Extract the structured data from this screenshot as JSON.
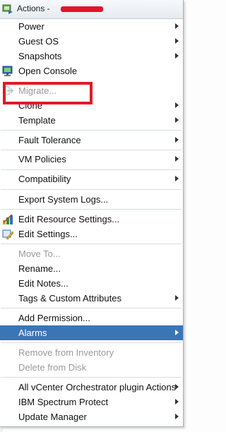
{
  "menu": {
    "title": "Actions -",
    "items": [
      {
        "label": "Power",
        "submenu": true,
        "disabled": false
      },
      {
        "label": "Guest OS",
        "submenu": true,
        "disabled": false
      },
      {
        "label": "Snapshots",
        "submenu": true,
        "disabled": false
      },
      {
        "label": "Open Console",
        "submenu": false,
        "disabled": false,
        "icon": "console-icon"
      },
      {
        "label": "Migrate...",
        "submenu": false,
        "disabled": true,
        "icon": "migrate-icon"
      },
      {
        "label": "Clone",
        "submenu": true,
        "disabled": false
      },
      {
        "label": "Template",
        "submenu": true,
        "disabled": false
      },
      {
        "label": "Fault Tolerance",
        "submenu": true,
        "disabled": false
      },
      {
        "label": "VM Policies",
        "submenu": true,
        "disabled": false
      },
      {
        "label": "Compatibility",
        "submenu": true,
        "disabled": false
      },
      {
        "label": "Export System Logs...",
        "submenu": false,
        "disabled": false
      },
      {
        "label": "Edit Resource Settings...",
        "submenu": false,
        "disabled": false,
        "icon": "resource-settings-icon"
      },
      {
        "label": "Edit Settings...",
        "submenu": false,
        "disabled": false,
        "icon": "edit-settings-icon"
      },
      {
        "label": "Move To...",
        "submenu": false,
        "disabled": true
      },
      {
        "label": "Rename...",
        "submenu": false,
        "disabled": false
      },
      {
        "label": "Edit Notes...",
        "submenu": false,
        "disabled": false
      },
      {
        "label": "Tags & Custom Attributes",
        "submenu": true,
        "disabled": false
      },
      {
        "label": "Add Permission...",
        "submenu": false,
        "disabled": false
      },
      {
        "label": "Alarms",
        "submenu": true,
        "disabled": false,
        "highlighted": true
      },
      {
        "label": "Remove from Inventory",
        "submenu": false,
        "disabled": true
      },
      {
        "label": "Delete from Disk",
        "submenu": false,
        "disabled": true
      },
      {
        "label": "All vCenter Orchestrator plugin Actions",
        "submenu": true,
        "disabled": false
      },
      {
        "label": "IBM Spectrum Protect",
        "submenu": true,
        "disabled": false
      },
      {
        "label": "Update Manager",
        "submenu": true,
        "disabled": false
      }
    ]
  },
  "colors": {
    "highlight": "#3b75b5",
    "annotation": "#e01b24",
    "redaction": "#e5132b",
    "disabled_text": "#9a9a9a"
  }
}
